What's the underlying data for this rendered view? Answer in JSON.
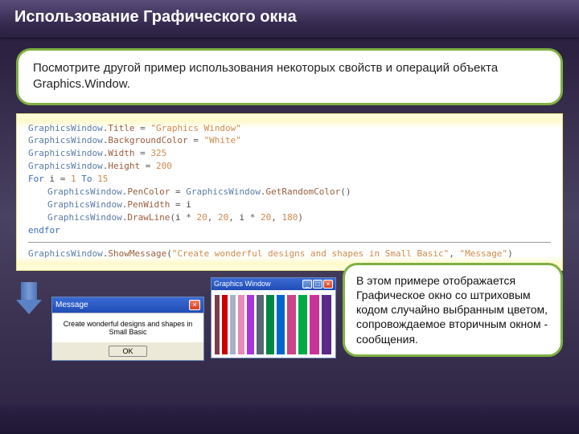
{
  "title": "Использование Графического окна",
  "description": "Посмотрите другой пример использования некоторых свойств и операций объекта Graphics.Window.",
  "code": {
    "l1": {
      "obj": "GraphicsWindow",
      "dot": ".",
      "prop": "Title",
      "op": " = ",
      "val": "\"Graphics Window\""
    },
    "l2": {
      "obj": "GraphicsWindow",
      "dot": ".",
      "prop": "BackgroundColor",
      "op": " = ",
      "val": "\"White\""
    },
    "l3": {
      "obj": "GraphicsWindow",
      "dot": ".",
      "prop": "Width",
      "op": " = ",
      "val": "325"
    },
    "l4": {
      "obj": "GraphicsWindow",
      "dot": ".",
      "prop": "Height",
      "op": " = ",
      "val": "200"
    },
    "l5": {
      "kw1": "For ",
      "var": "i",
      "op": " = ",
      "n1": "1",
      "kw2": " To ",
      "n2": "15"
    },
    "l6": {
      "obj": "GraphicsWindow",
      "dot": ".",
      "prop": "PenColor",
      "op": " = ",
      "obj2": "GraphicsWindow",
      "dot2": ".",
      "prop2": "GetRandomColor",
      "par": "()"
    },
    "l7": {
      "obj": "GraphicsWindow",
      "dot": ".",
      "prop": "PenWidth",
      "op": " = ",
      "var": "i"
    },
    "l8": {
      "obj": "GraphicsWindow",
      "dot": ".",
      "prop": "DrawLine",
      "par1": "(",
      "v1": "i",
      "op1": " * ",
      "n1": "20",
      "c1": ", ",
      "n2": "20",
      "c2": ", ",
      "v2": "i",
      "op2": " * ",
      "n3": "20",
      "c3": ", ",
      "n4": "180",
      "par2": ")"
    },
    "l9": {
      "kw": "endfor"
    },
    "l10": {
      "obj": "GraphicsWindow",
      "dot": ".",
      "prop": "ShowMessage",
      "par1": "(",
      "s1": "\"Create wonderful designs and shapes in Small Basic\"",
      "c": ", ",
      "s2": "\"Message\"",
      "par2": ")"
    }
  },
  "message_window": {
    "title": "Message",
    "body": "Create wonderful designs and shapes in Small Basic",
    "ok": "OK"
  },
  "graphics_window": {
    "title": "Graphics Window",
    "bars": [
      {
        "c": "#7a3d4a",
        "w": 6
      },
      {
        "c": "#cc0000",
        "w": 7
      },
      {
        "c": "#aab0c8",
        "w": 7
      },
      {
        "c": "#e68ab8",
        "w": 8
      },
      {
        "c": "#aa33dd",
        "w": 9
      },
      {
        "c": "#556677",
        "w": 9
      },
      {
        "c": "#008844",
        "w": 10
      },
      {
        "c": "#0066cc",
        "w": 10
      },
      {
        "c": "#cc4488",
        "w": 11
      },
      {
        "c": "#00aa44",
        "w": 11
      },
      {
        "c": "#cc3399",
        "w": 12
      },
      {
        "c": "#5a2a88",
        "w": 12
      }
    ]
  },
  "callout": "В этом примере отображается Графическое окно со штриховым кодом случайно выбранным цветом, сопровождаемое вторичным окном - сообщения.",
  "icons": {
    "close": "×",
    "min": "_",
    "max": "□"
  }
}
